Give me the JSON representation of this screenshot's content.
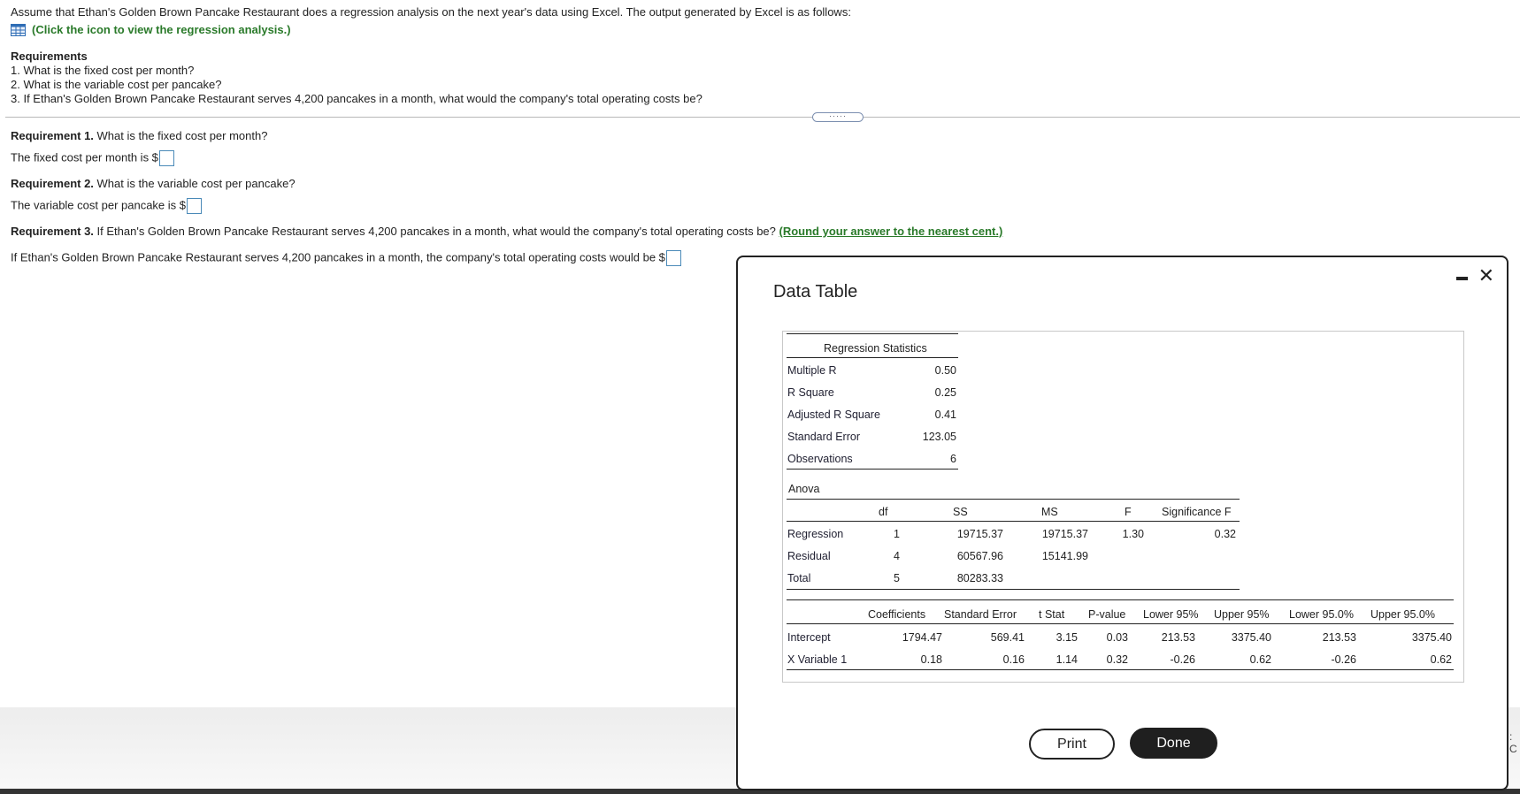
{
  "intro": {
    "text": "Assume that Ethan's Golden Brown Pancake Restaurant does a regression analysis on the next year's data using Excel. The output generated by Excel is as follows:",
    "link": "(Click the icon to view the regression analysis.)",
    "icon": "grid-icon"
  },
  "requirements": {
    "title": "Requirements",
    "items": [
      "1. What is the fixed cost per month?",
      "2. What is the variable cost per pancake?",
      "3. If Ethan's Golden Brown Pancake Restaurant serves 4,200 pancakes in a month, what would the company's total operating costs be?"
    ]
  },
  "more_pill": "·····",
  "questions": {
    "r1_label": "Requirement 1.",
    "r1_text": " What is the fixed cost per month?",
    "r1_answer": "The fixed cost per month is $",
    "r2_label": "Requirement 2.",
    "r2_text": " What is the variable cost per pancake?",
    "r2_answer": "The variable cost per pancake is $",
    "r3_label": "Requirement 3.",
    "r3_text": " If Ethan's Golden Brown Pancake Restaurant serves 4,200 pancakes in a month, what would the company's total operating costs be?",
    "r3_hint": "(Round your answer to the nearest cent.)",
    "r3_answer": "If Ethan's Golden Brown Pancake Restaurant serves 4,200 pancakes in a month, the company's total operating costs would be $"
  },
  "modal": {
    "title": "Data Table",
    "regression_statistics": {
      "header": "Regression Statistics",
      "rows": [
        {
          "label": "Multiple R",
          "value": "0.50"
        },
        {
          "label": "R Square",
          "value": "0.25"
        },
        {
          "label": "Adjusted R Square",
          "value": "0.41"
        },
        {
          "label": "Standard Error",
          "value": "123.05"
        },
        {
          "label": "Observations",
          "value": "6"
        }
      ]
    },
    "anova": {
      "title": "Anova",
      "headers": [
        "df",
        "SS",
        "MS",
        "F",
        "Significance F"
      ],
      "rows": [
        {
          "label": "Regression",
          "df": "1",
          "ss": "19715.37",
          "ms": "19715.37",
          "f": "1.30",
          "sig": "0.32"
        },
        {
          "label": "Residual",
          "df": "4",
          "ss": "60567.96",
          "ms": "15141.99",
          "f": "",
          "sig": ""
        },
        {
          "label": "Total",
          "df": "5",
          "ss": "80283.33",
          "ms": "",
          "f": "",
          "sig": ""
        }
      ]
    },
    "coefficients": {
      "headers": [
        "Coefficients",
        "Standard Error",
        "t Stat",
        "P-value",
        "Lower 95%",
        "Upper 95%",
        "Lower 95.0%",
        "Upper 95.0%"
      ],
      "rows": [
        {
          "label": "Intercept",
          "cells": [
            "1794.47",
            "569.41",
            "3.15",
            "0.03",
            "213.53",
            "3375.40",
            "213.53",
            "3375.40"
          ]
        },
        {
          "label": "X Variable 1",
          "cells": [
            "0.18",
            "0.16",
            "1.14",
            "0.32",
            "-0.26",
            "0.62",
            "-0.26",
            "0.62"
          ]
        }
      ]
    },
    "print_label": "Print",
    "done_label": "Done"
  },
  "edge_text": ": C"
}
